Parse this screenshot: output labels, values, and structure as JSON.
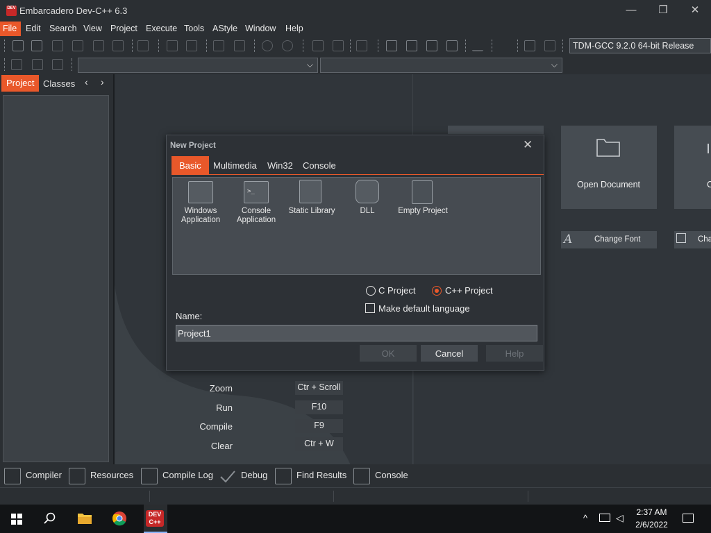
{
  "window": {
    "title": "Embarcadero Dev-C++ 6.3",
    "icon_text": "DEV",
    "minimize": "—",
    "maximize": "❐",
    "close": "✕"
  },
  "menu": [
    "File",
    "Edit",
    "Search",
    "View",
    "Project",
    "Execute",
    "Tools",
    "AStyle",
    "Window",
    "Help"
  ],
  "toolbar": {
    "compiler": "TDM-GCC 9.2.0 64-bit Release"
  },
  "left_panel": {
    "tabs": [
      "Project",
      "Classes"
    ],
    "prev": "‹",
    "next": "›"
  },
  "welcome": {
    "cards": [
      "Open Document",
      "C"
    ],
    "buttons": [
      "Change Font",
      "Cha"
    ],
    "shortcuts": [
      {
        "label": "Zoom",
        "key": "Ctr + Scroll"
      },
      {
        "label": "Run",
        "key": "F10"
      },
      {
        "label": "Compile",
        "key": "F9"
      },
      {
        "label": "Clear",
        "key": "Ctr + W"
      }
    ]
  },
  "dialog": {
    "title": "New Project",
    "close": "✕",
    "tabs": [
      "Basic",
      "Multimedia",
      "Win32",
      "Console"
    ],
    "templates": [
      {
        "label": "Windows\nApplication",
        "icon": "windows-app-icon"
      },
      {
        "label": "Console\nApplication",
        "icon": "console-app-icon"
      },
      {
        "label": "Static Library",
        "icon": "static-library-icon"
      },
      {
        "label": "DLL",
        "icon": "dll-icon"
      },
      {
        "label": "Empty Project",
        "icon": "empty-project-icon"
      }
    ],
    "lang_c": "C Project",
    "lang_cpp": "C++ Project",
    "selected_language": "C++ Project",
    "default_lang": "Make default language",
    "default_lang_checked": false,
    "name_label": "Name:",
    "name_value": "Project1",
    "ok": "OK",
    "cancel": "Cancel",
    "help": "Help"
  },
  "bottom_tabs": [
    "Compiler",
    "Resources",
    "Compile Log",
    "Debug",
    "Find Results",
    "Console"
  ],
  "taskbar": {
    "time": "2:37 AM",
    "date": "2/6/2022",
    "devcpp": "DEV C++"
  },
  "colors": {
    "accent": "#e9582a",
    "background": "#30353a"
  }
}
